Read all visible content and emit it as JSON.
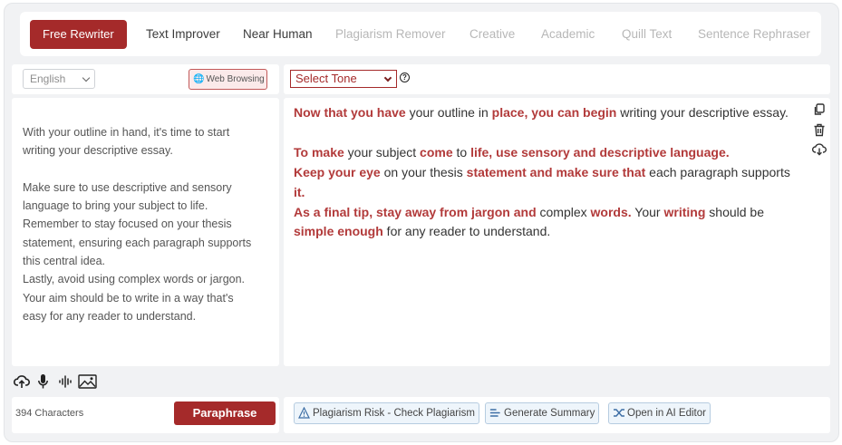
{
  "tabs": [
    {
      "label": "Free Rewriter",
      "active": true
    },
    {
      "label": "Text Improver"
    },
    {
      "label": "Near Human"
    },
    {
      "label": "Plagiarism Remover"
    },
    {
      "label": "Creative"
    },
    {
      "label": "Academic"
    },
    {
      "label": "Quill Text"
    },
    {
      "label": "Sentence Rephraser"
    }
  ],
  "left_toolbar": {
    "language_value": "English",
    "web_browsing_label": "Web Browsing"
  },
  "right_toolbar": {
    "tone_value": "Select Tone",
    "help_glyph": "?"
  },
  "input": {
    "paragraphs": [
      [
        "With your outline in hand, it's time to start",
        "writing your descriptive essay."
      ],
      [
        "Make sure to use descriptive and sensory",
        "language to bring your subject to life.",
        "Remember to stay focused on your thesis",
        "statement, ensuring each paragraph supports",
        "this central idea.",
        "Lastly, avoid using complex words or jargon.",
        "Your aim should be to write in a way that's",
        "easy for any reader to understand."
      ]
    ]
  },
  "output": {
    "lines": [
      [
        {
          "t": "Now that you have",
          "h": true
        },
        {
          "t": " your outline in "
        },
        {
          "t": "place, you can begin",
          "h": true
        },
        {
          "t": " writing your descriptive essay."
        }
      ],
      [],
      [
        {
          "t": "To make",
          "h": true
        },
        {
          "t": " your subject "
        },
        {
          "t": "come",
          "h": true
        },
        {
          "t": " to "
        },
        {
          "t": "life, use sensory and descriptive language.",
          "h": true
        }
      ],
      [
        {
          "t": "Keep your eye",
          "h": true
        },
        {
          "t": " on your thesis "
        },
        {
          "t": "statement and make sure that",
          "h": true
        },
        {
          "t": " each paragraph supports"
        }
      ],
      [
        {
          "t": "it.",
          "h": true
        }
      ],
      [
        {
          "t": "As a final tip, stay away from jargon and",
          "h": true
        },
        {
          "t": " complex "
        },
        {
          "t": "words.",
          "h": true
        },
        {
          "t": " Your "
        },
        {
          "t": "writing",
          "h": true
        },
        {
          "t": " should be"
        }
      ],
      [
        {
          "t": "simple enough",
          "h": true
        },
        {
          "t": " for any reader to understand."
        }
      ]
    ]
  },
  "footer": {
    "char_count": "394 Characters",
    "paraphrase_label": "Paraphrase",
    "plagiarism_label": "Plagiarism Risk - Check Plagiarism",
    "summary_label": "Generate Summary",
    "ai_editor_label": "Open in AI Editor"
  },
  "colors": {
    "accent": "#a52a2a",
    "highlight": "#b23a3a"
  }
}
